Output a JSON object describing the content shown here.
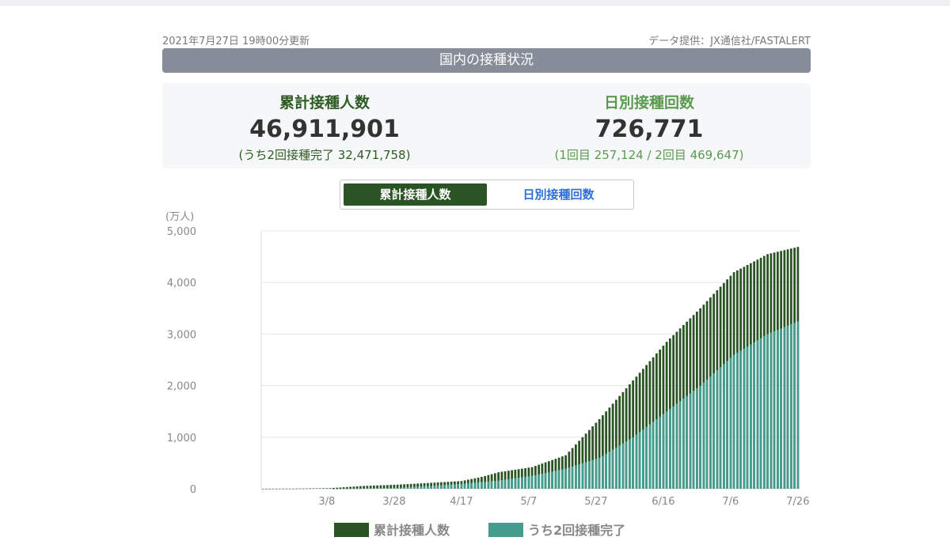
{
  "header": {
    "updated": "2021年7月27日 19時00分更新",
    "source": "データ提供：JX通信社/FASTALERT",
    "title": "国内の接種状況"
  },
  "stats": {
    "cumulative": {
      "label": "累計接種人数",
      "value": "46,911,901",
      "sub": "(うち2回接種完了 32,471,758)"
    },
    "daily": {
      "label": "日別接種回数",
      "value": "726,771",
      "sub": "(1回目 257,124 / 2回目 469,647)"
    }
  },
  "toggle": {
    "active": "累計接種人数",
    "inactive": "日別接種回数"
  },
  "colors": {
    "cumulative": "#2a5424",
    "second_dose": "#449c8c",
    "accent_blue": "#2a6fd6"
  },
  "chart_data": {
    "type": "bar",
    "stacked": false,
    "overlay": true,
    "unit_label": "(万人)",
    "ylim": [
      0,
      5000
    ],
    "yticks": [
      "0",
      "1,000",
      "2,000",
      "3,000",
      "4,000",
      "5,000"
    ],
    "grid": true,
    "legend_position": "bottom",
    "x_range": [
      "2/17",
      "7/26"
    ],
    "x_tick_labels": [
      "3/8",
      "3/28",
      "4/17",
      "5/7",
      "5/27",
      "6/16",
      "7/6",
      "7/26"
    ],
    "series": [
      {
        "name": "累計接種人数",
        "keypoints_day_value": [
          [
            0,
            0
          ],
          [
            10,
            3
          ],
          [
            20,
            12
          ],
          [
            30,
            55
          ],
          [
            40,
            80
          ],
          [
            50,
            115
          ],
          [
            59,
            150
          ],
          [
            65,
            230
          ],
          [
            70,
            320
          ],
          [
            80,
            420
          ],
          [
            90,
            650
          ],
          [
            95,
            1000
          ],
          [
            100,
            1350
          ],
          [
            110,
            2100
          ],
          [
            120,
            2850
          ],
          [
            130,
            3500
          ],
          [
            140,
            4200
          ],
          [
            150,
            4550
          ],
          [
            159,
            4690
          ]
        ]
      },
      {
        "name": "うち2回接種完了",
        "keypoints_day_value": [
          [
            0,
            0
          ],
          [
            20,
            0
          ],
          [
            25,
            2
          ],
          [
            40,
            18
          ],
          [
            50,
            55
          ],
          [
            59,
            95
          ],
          [
            70,
            160
          ],
          [
            80,
            250
          ],
          [
            90,
            390
          ],
          [
            100,
            600
          ],
          [
            110,
            1000
          ],
          [
            120,
            1500
          ],
          [
            130,
            2000
          ],
          [
            140,
            2600
          ],
          [
            150,
            3000
          ],
          [
            159,
            3247
          ]
        ]
      }
    ]
  }
}
